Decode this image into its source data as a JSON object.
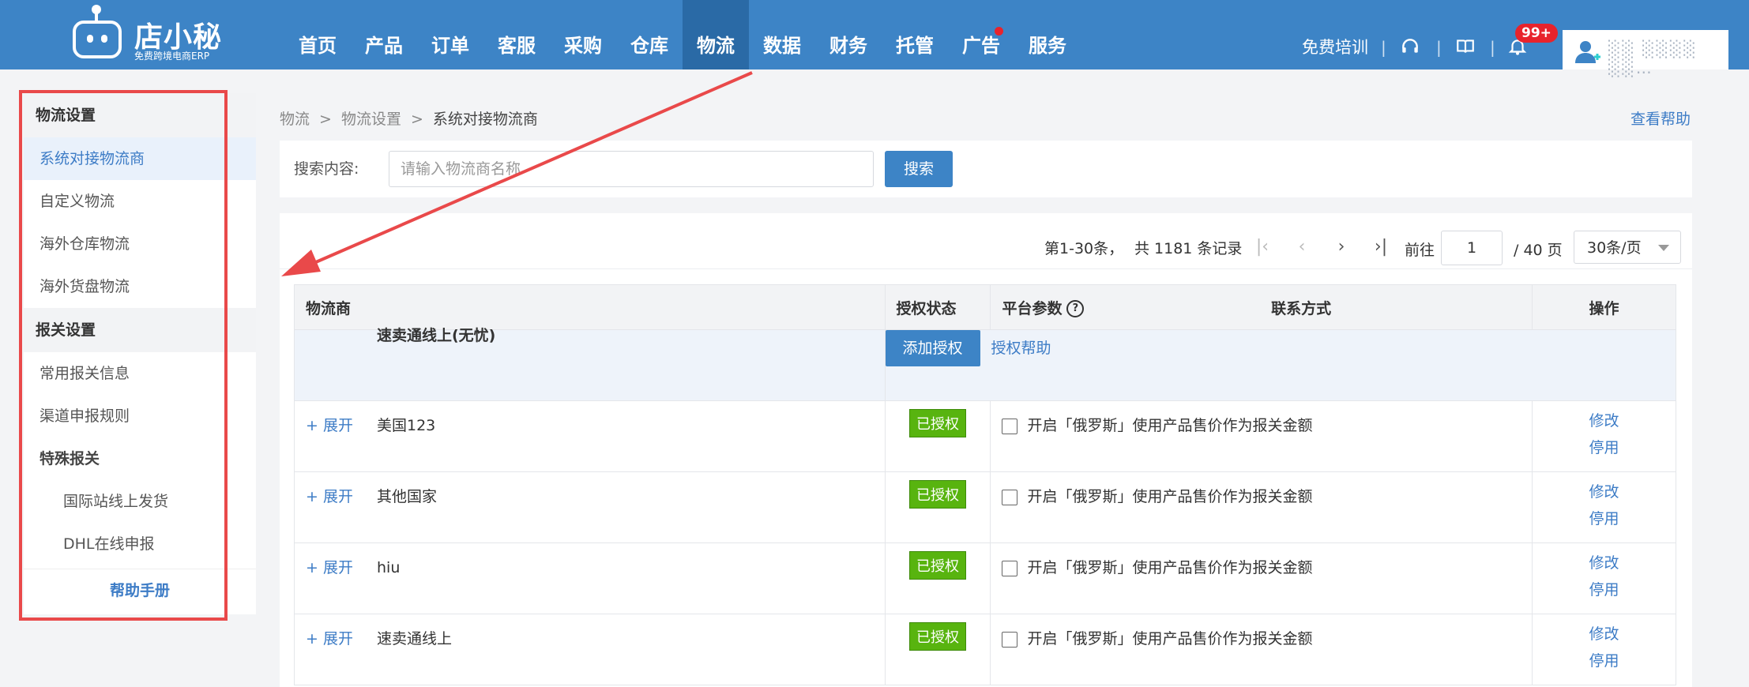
{
  "header": {
    "logo_title": "店小秘",
    "logo_subtitle": "免费跨境电商ERP",
    "nav": [
      {
        "label": "首页",
        "active": false
      },
      {
        "label": "产品",
        "active": false
      },
      {
        "label": "订单",
        "active": false
      },
      {
        "label": "客服",
        "active": false
      },
      {
        "label": "采购",
        "active": false
      },
      {
        "label": "仓库",
        "active": false
      },
      {
        "label": "物流",
        "active": true
      },
      {
        "label": "数据",
        "active": false
      },
      {
        "label": "财务",
        "active": false
      },
      {
        "label": "托管",
        "active": false
      },
      {
        "label": "广告",
        "active": false,
        "dot": true
      },
      {
        "label": "服务",
        "active": false
      }
    ],
    "free_training": "免费培训",
    "notification_badge": "99+",
    "user_name": "░░ ░░░░ ░░…",
    "icons": [
      "headset-icon",
      "book-icon",
      "bell-icon",
      "user-icon"
    ],
    "colors": {
      "primary": "#3d84c6",
      "nav_active": "#2a6aa6",
      "badge": "#e8232c"
    }
  },
  "sidebar": {
    "sections": [
      {
        "title": "物流设置",
        "items": [
          {
            "label": "系统对接物流商",
            "active": true
          },
          {
            "label": "自定义物流"
          },
          {
            "label": "海外仓库物流"
          },
          {
            "label": "海外货盘物流"
          }
        ]
      },
      {
        "title": "报关设置",
        "items": [
          {
            "label": "常用报关信息"
          },
          {
            "label": "渠道申报规则"
          },
          {
            "label": "特殊报关",
            "bold": true
          },
          {
            "label": "国际站线上发货",
            "sub": true
          },
          {
            "label": "DHL在线申报",
            "sub": true
          }
        ]
      }
    ],
    "help": "帮助手册"
  },
  "breadcrumb": {
    "items": [
      "物流",
      "物流设置",
      "系统对接物流商"
    ],
    "separator": ">"
  },
  "help_link": "查看帮助",
  "search": {
    "label": "搜索内容:",
    "placeholder": "请输入物流商名称",
    "value": "",
    "button": "搜索"
  },
  "pager": {
    "range": "第1-30条，",
    "total": "共 1181 条记录",
    "goto_label": "前往",
    "page": "1",
    "pages": "/ 40  页",
    "per_page": "30条/页"
  },
  "table": {
    "headers": {
      "carrier": "物流商",
      "status": "授权状态",
      "params": "平台参数",
      "contact": "联系方式",
      "ops": "操作"
    },
    "group": {
      "name": "速卖通线上(无忧)",
      "add_button": "添加授权",
      "help_link": "授权帮助"
    },
    "expand_label": "+ 展开",
    "checkbox_label": "开启「俄罗斯」使用产品售价作为报关金额",
    "edit_label": "修改",
    "disable_label": "停用",
    "rows": [
      {
        "name": "美国123",
        "status": "已授权"
      },
      {
        "name": "其他国家",
        "status": "已授权"
      },
      {
        "name": "hiu",
        "status": "已授权"
      },
      {
        "name": "速卖通线上",
        "status": "已授权"
      }
    ]
  },
  "annotation": {
    "color": "#e9494a"
  }
}
